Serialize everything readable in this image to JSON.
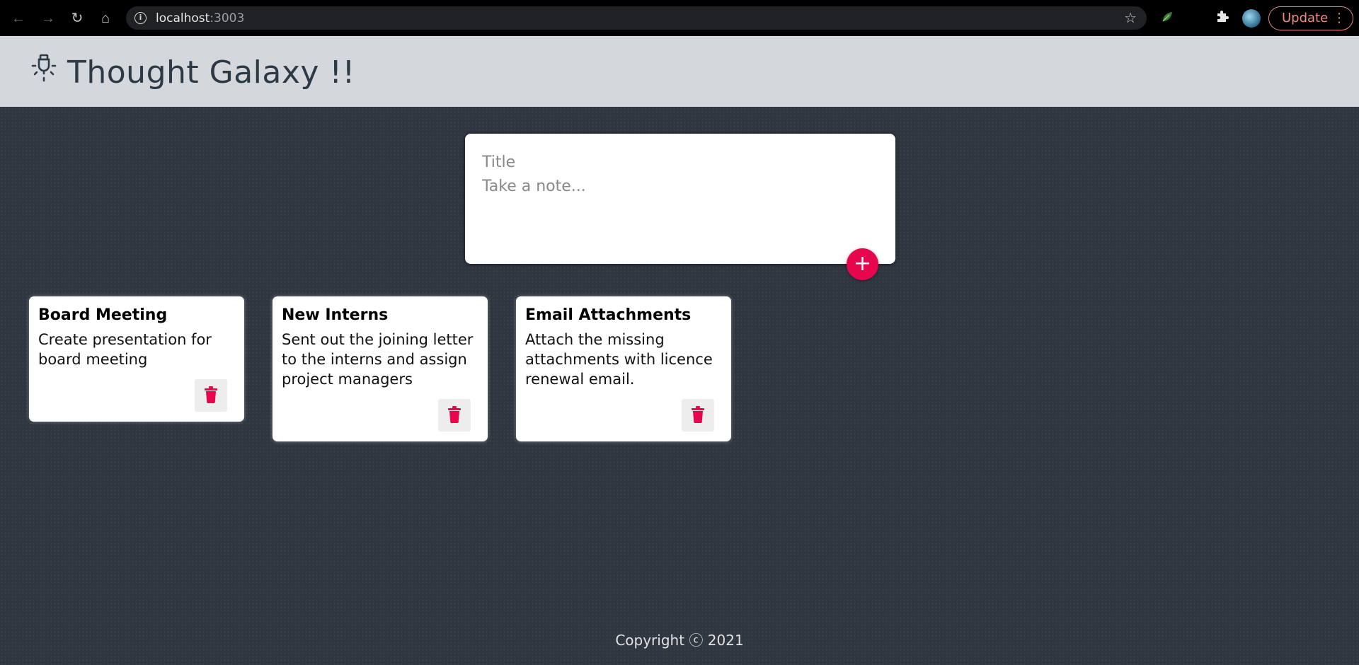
{
  "browser": {
    "url_host": "localhost",
    "url_port": ":3003",
    "update_label": "Update",
    "info_glyph": "i",
    "icons": [
      "back-icon",
      "forward-icon",
      "reload-icon",
      "home-icon",
      "info-icon",
      "star-icon",
      "extension-leaf-icon",
      "puzzle-icon",
      "profile-avatar",
      "menu-dots-icon"
    ]
  },
  "app": {
    "title": "Thought Galaxy !!",
    "logo_icon": "lightbulb-icon",
    "accent_color": "#e6064e"
  },
  "create_note": {
    "title_placeholder": "Title",
    "content_placeholder": "Take a note...",
    "add_icon": "plus-icon"
  },
  "notes": [
    {
      "title": "Board Meeting",
      "content": "Create presentation for board meeting"
    },
    {
      "title": "New Interns",
      "content": "Sent out the joining letter to the interns and assign project managers"
    },
    {
      "title": "Email Attachments",
      "content": "Attach the missing attachments with licence renewal email."
    }
  ],
  "footer": {
    "text": "Copyright ⓒ 2021"
  }
}
